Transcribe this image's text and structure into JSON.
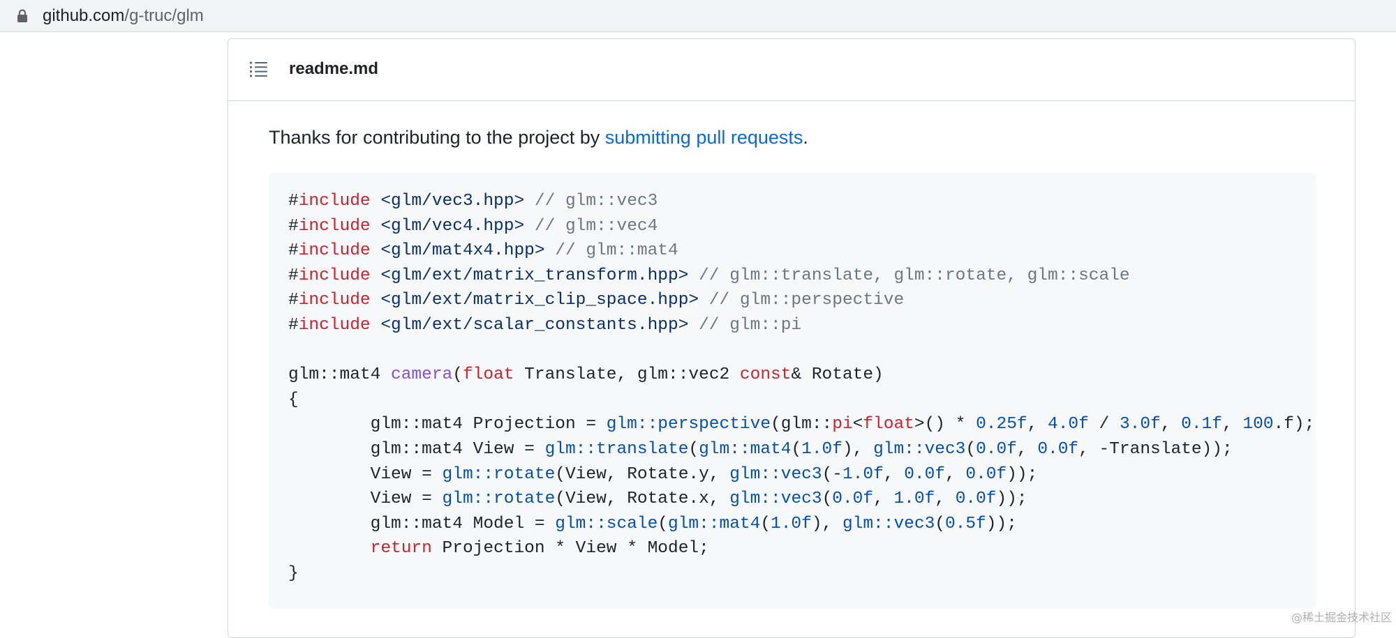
{
  "browser": {
    "url_host": "github.com",
    "url_path": "/g-truc/glm"
  },
  "readme": {
    "title": "readme.md",
    "intro_before": "Thanks for contributing to the project by ",
    "intro_link": "submitting pull requests",
    "intro_after": "."
  },
  "code": {
    "language": "cpp",
    "lines": [
      [
        {
          "t": "pl",
          "v": "#"
        },
        {
          "t": "kw",
          "v": "include"
        },
        {
          "t": "pl",
          "v": " "
        },
        {
          "t": "str",
          "v": "<glm/vec3.hpp>"
        },
        {
          "t": "pl",
          "v": " "
        },
        {
          "t": "com",
          "v": "// glm::vec3"
        }
      ],
      [
        {
          "t": "pl",
          "v": "#"
        },
        {
          "t": "kw",
          "v": "include"
        },
        {
          "t": "pl",
          "v": " "
        },
        {
          "t": "str",
          "v": "<glm/vec4.hpp>"
        },
        {
          "t": "pl",
          "v": " "
        },
        {
          "t": "com",
          "v": "// glm::vec4"
        }
      ],
      [
        {
          "t": "pl",
          "v": "#"
        },
        {
          "t": "kw",
          "v": "include"
        },
        {
          "t": "pl",
          "v": " "
        },
        {
          "t": "str",
          "v": "<glm/mat4x4.hpp>"
        },
        {
          "t": "pl",
          "v": " "
        },
        {
          "t": "com",
          "v": "// glm::mat4"
        }
      ],
      [
        {
          "t": "pl",
          "v": "#"
        },
        {
          "t": "kw",
          "v": "include"
        },
        {
          "t": "pl",
          "v": " "
        },
        {
          "t": "str",
          "v": "<glm/ext/matrix_transform.hpp>"
        },
        {
          "t": "pl",
          "v": " "
        },
        {
          "t": "com",
          "v": "// glm::translate, glm::rotate, glm::scale"
        }
      ],
      [
        {
          "t": "pl",
          "v": "#"
        },
        {
          "t": "kw",
          "v": "include"
        },
        {
          "t": "pl",
          "v": " "
        },
        {
          "t": "str",
          "v": "<glm/ext/matrix_clip_space.hpp>"
        },
        {
          "t": "pl",
          "v": " "
        },
        {
          "t": "com",
          "v": "// glm::perspective"
        }
      ],
      [
        {
          "t": "pl",
          "v": "#"
        },
        {
          "t": "kw",
          "v": "include"
        },
        {
          "t": "pl",
          "v": " "
        },
        {
          "t": "str",
          "v": "<glm/ext/scalar_constants.hpp>"
        },
        {
          "t": "pl",
          "v": " "
        },
        {
          "t": "com",
          "v": "// glm::pi"
        }
      ],
      [],
      [
        {
          "t": "pl",
          "v": "glm::mat4 "
        },
        {
          "t": "fn",
          "v": "camera"
        },
        {
          "t": "pl",
          "v": "("
        },
        {
          "t": "kw",
          "v": "float"
        },
        {
          "t": "pl",
          "v": " Translate, glm::vec2 "
        },
        {
          "t": "kw",
          "v": "const"
        },
        {
          "t": "pl",
          "v": "& Rotate)"
        }
      ],
      [
        {
          "t": "pl",
          "v": "{"
        }
      ],
      [
        {
          "t": "pl",
          "v": "        glm::mat4 Projection = "
        },
        {
          "t": "ent",
          "v": "glm::perspective"
        },
        {
          "t": "pl",
          "v": "(glm::"
        },
        {
          "t": "kw",
          "v": "pi"
        },
        {
          "t": "pl",
          "v": "<"
        },
        {
          "t": "kw",
          "v": "float"
        },
        {
          "t": "pl",
          "v": ">() * "
        },
        {
          "t": "num",
          "v": "0.25f"
        },
        {
          "t": "pl",
          "v": ", "
        },
        {
          "t": "num",
          "v": "4.0f"
        },
        {
          "t": "pl",
          "v": " / "
        },
        {
          "t": "num",
          "v": "3.0f"
        },
        {
          "t": "pl",
          "v": ", "
        },
        {
          "t": "num",
          "v": "0.1f"
        },
        {
          "t": "pl",
          "v": ", "
        },
        {
          "t": "num",
          "v": "100"
        },
        {
          "t": "pl",
          "v": ".f);"
        }
      ],
      [
        {
          "t": "pl",
          "v": "        glm::mat4 View = "
        },
        {
          "t": "ent",
          "v": "glm::translate"
        },
        {
          "t": "pl",
          "v": "("
        },
        {
          "t": "ent",
          "v": "glm::mat4"
        },
        {
          "t": "pl",
          "v": "("
        },
        {
          "t": "num",
          "v": "1.0f"
        },
        {
          "t": "pl",
          "v": "), "
        },
        {
          "t": "ent",
          "v": "glm::vec3"
        },
        {
          "t": "pl",
          "v": "("
        },
        {
          "t": "num",
          "v": "0.0f"
        },
        {
          "t": "pl",
          "v": ", "
        },
        {
          "t": "num",
          "v": "0.0f"
        },
        {
          "t": "pl",
          "v": ", -Translate));"
        }
      ],
      [
        {
          "t": "pl",
          "v": "        View = "
        },
        {
          "t": "ent",
          "v": "glm::rotate"
        },
        {
          "t": "pl",
          "v": "(View, Rotate.y, "
        },
        {
          "t": "ent",
          "v": "glm::vec3"
        },
        {
          "t": "pl",
          "v": "(-"
        },
        {
          "t": "num",
          "v": "1.0f"
        },
        {
          "t": "pl",
          "v": ", "
        },
        {
          "t": "num",
          "v": "0.0f"
        },
        {
          "t": "pl",
          "v": ", "
        },
        {
          "t": "num",
          "v": "0.0f"
        },
        {
          "t": "pl",
          "v": "));"
        }
      ],
      [
        {
          "t": "pl",
          "v": "        View = "
        },
        {
          "t": "ent",
          "v": "glm::rotate"
        },
        {
          "t": "pl",
          "v": "(View, Rotate.x, "
        },
        {
          "t": "ent",
          "v": "glm::vec3"
        },
        {
          "t": "pl",
          "v": "("
        },
        {
          "t": "num",
          "v": "0.0f"
        },
        {
          "t": "pl",
          "v": ", "
        },
        {
          "t": "num",
          "v": "1.0f"
        },
        {
          "t": "pl",
          "v": ", "
        },
        {
          "t": "num",
          "v": "0.0f"
        },
        {
          "t": "pl",
          "v": "));"
        }
      ],
      [
        {
          "t": "pl",
          "v": "        glm::mat4 Model = "
        },
        {
          "t": "ent",
          "v": "glm::scale"
        },
        {
          "t": "pl",
          "v": "("
        },
        {
          "t": "ent",
          "v": "glm::mat4"
        },
        {
          "t": "pl",
          "v": "("
        },
        {
          "t": "num",
          "v": "1.0f"
        },
        {
          "t": "pl",
          "v": "), "
        },
        {
          "t": "ent",
          "v": "glm::vec3"
        },
        {
          "t": "pl",
          "v": "("
        },
        {
          "t": "num",
          "v": "0.5f"
        },
        {
          "t": "pl",
          "v": "));"
        }
      ],
      [
        {
          "t": "pl",
          "v": "        "
        },
        {
          "t": "kw",
          "v": "return"
        },
        {
          "t": "pl",
          "v": " Projection * View * Model;"
        }
      ],
      [
        {
          "t": "pl",
          "v": "}"
        }
      ]
    ]
  },
  "watermark": "@稀土掘金技术社区",
  "icons": {
    "lock": "lock-icon",
    "toc": "list-unordered-icon"
  },
  "colors": {
    "keyword": "#cf222e",
    "string": "#0a3069",
    "comment": "#6e7781",
    "function": "#8250df",
    "entity": "#0550ae",
    "link": "#0969da",
    "code_bg": "#f6f8fa"
  }
}
